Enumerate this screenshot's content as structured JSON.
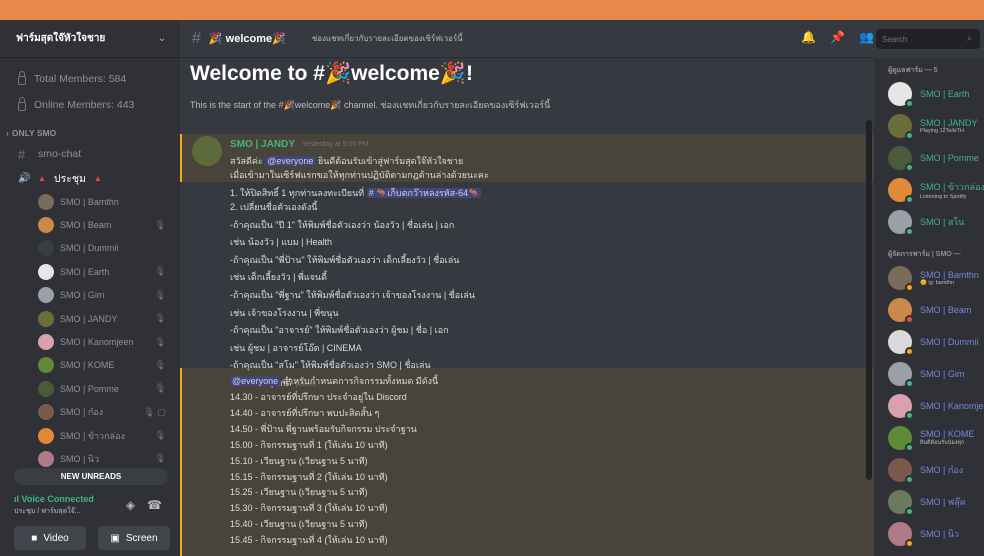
{
  "server": {
    "name": "ฟาร์มสุดใจ๊หัวใจชาย"
  },
  "stats": [
    "Total Members: 584",
    "Online Members: 443"
  ],
  "category": "ONLY SMO",
  "channels": {
    "text": "smo-chat",
    "voice": "ประชุม"
  },
  "voice_users": [
    {
      "name": "SMO | Bamthn",
      "color": "#7a6a5a",
      "mic": ""
    },
    {
      "name": "SMO | Beam",
      "color": "#c9894a",
      "mic": "🎙"
    },
    {
      "name": "SMO | Dummii",
      "color": "#3a3d44",
      "mic": ""
    },
    {
      "name": "SMO | Earth",
      "color": "#e6e6e6",
      "mic": "🎙"
    },
    {
      "name": "SMO | Gim",
      "color": "#9aa0a8",
      "mic": "🎙"
    },
    {
      "name": "SMO | JANDY",
      "color": "#6b6e3a",
      "mic": "🎙"
    },
    {
      "name": "SMO | Kanomjeen",
      "color": "#d9a0b0",
      "mic": "🎙"
    },
    {
      "name": "SMO | KOME",
      "color": "#5f8a3a",
      "mic": "🎙"
    },
    {
      "name": "SMO | Pomme",
      "color": "#4a5a3a",
      "mic": "🎙"
    },
    {
      "name": "SMO | ก๋อง",
      "color": "#7a5a4a",
      "mic": "🎙 ▢"
    },
    {
      "name": "SMO | ข้าวกล่อง",
      "color": "#e08a3a",
      "mic": "🎙"
    },
    {
      "name": "SMO | นิว",
      "color": "#b07a8a",
      "mic": "🎙"
    }
  ],
  "unread_label": "NEW UNREADS",
  "voice_panel": {
    "title": "Voice Connected",
    "sub": "ประชุม / ฟาร์มสุดใจ๊...",
    "video": "Video",
    "screen": "Screen"
  },
  "header": {
    "channel": "welcome",
    "topic": "ช่องแชทเกี่ยวกับรายละเอียดของเซิร์ฟเวอร์นี้"
  },
  "search": {
    "placeholder": "Search"
  },
  "welcome": {
    "title": "Welcome to #🎉welcome🎉!",
    "sub": "This is the start of the #🎉welcome🎉 channel. ช่องแชทเกี่ยวกับรายละเอียดของเซิร์ฟเวอร์นี้"
  },
  "message": {
    "author": "SMO | JANDY",
    "time": "Yesterday at 9:00 PM",
    "greeting_pre": "สวัสดีค่ะ",
    "mention": "@everyone",
    "greeting_post": "ยินดีต้อนรับเข้าสู่ฟาร์มสุดใจ๊หัวใจชาย",
    "l2": "เมื่อเข้ามาในเซิร์ฟแรกขอให้ทุกท่านปฏิบัติตามกฎด้านล่างด้วยนะคะ",
    "l3_pre": "1. ให้ปิดสิทธิ์ 1 ทุกท่านลงทะเบียนที่",
    "l3_chan": "# 🦘เก็บตกว๊าหลงรหัส-64🦘",
    "lines": [
      "2. เปลี่ยนชื่อตัวเองดังนี้",
      "-ถ้าคุณเป็น \"ปี 1\" ให้พิมพ์ชื่อตัวเองว่า น้องวัว | ชื่อเล่น | เอก",
      "เช่น น้องวัว | แบม | Health",
      "-ถ้าคุณเป็น \"พี่ป้าน\" ให้พิมพ์ชื่อตัวเองว่า เด็กเลี้ยงวัว | ชื่อเล่น",
      "เช่น เด็กเลี้ยงวัว | พี่แจนดี้",
      "-ถ้าคุณเป็น \"พี่ฐาน\" ให้พิมพ์ชื่อตัวเองว่า เจ้าของโรงงาน | ชื่อเล่น",
      "เช่น เจ้าของโรงงาน | พี่ขนุน",
      "-ถ้าคุณเป็น \"อาจารย์\" ให้พิมพ์ชื่อตัวเองว่า ผู้ชม | ชื่อ | เอก",
      "เช่น ผู้ชม | อาจารย์โอ๊ต | CINEMA",
      "-ถ้าคุณเป็น \"สโม\" ให้พิมพ์ชื่อตัวเองว่า SMO | ชื่อเล่น",
      "เช่น SMO | ไกด์"
    ],
    "edited": "(edited)",
    "sched_mention": "@everyone",
    "sched_head": "สำหรับกำหนดการกิจกรรมทั้งหมด มีดังนี้",
    "schedule": [
      "14.30 - อาจารย์ที่ปรึกษา ประจำอยู่ใน Discord",
      "14.40 - อาจารย์ที่ปรึกษา พบปะสิดสั้น ๆ",
      "14.50 - พี่ป้าน พี่ฐานพร้อมรับกิจกรรม ประจำฐาน",
      "15.00 - กิจกรรมฐานที่ 1 (ให้เล่น 10 นาที)",
      "15.10 - เวียนฐาน (เวียนฐาน 5 นาที)",
      "15.15 - กิจกรรมฐานที่ 2 (ให้เล่น 10 นาที)",
      "15.25 - เวียนฐาน (เวียนฐาน 5 นาที)",
      "15.30 - กิจกรรมฐานที่ 3 (ให้เล่น 10 นาที)",
      "15.40 - เวียนฐาน (เวียนฐาน 5 นาที)",
      "15.45 - กิจกรรมฐานที่ 4 (ให้เล่น 10 นาที)"
    ]
  },
  "members": {
    "cat1": "ผู้ดูแลฟาร์ม — 5",
    "group1": [
      {
        "name": "SMO | Earth",
        "sub": "",
        "color": "#e6e6e6",
        "status": "#43b581",
        "ncolor": "#43b581"
      },
      {
        "name": "SMO | JANDY",
        "sub": "Playing 12TailsTH",
        "color": "#6b6e3a",
        "status": "#43b581",
        "ncolor": "#43b581"
      },
      {
        "name": "SMO | Pomme",
        "sub": "",
        "color": "#4a5a3a",
        "status": "#43b581",
        "ncolor": "#43b581"
      },
      {
        "name": "SMO | ข้าวกล่อง",
        "sub": "Listening to Spotify",
        "color": "#e08a3a",
        "status": "#43b581",
        "ncolor": "#43b581"
      },
      {
        "name": "SMO | สโน",
        "sub": "",
        "color": "#9aa0a8",
        "status": "#43b581",
        "ncolor": "#43b581"
      }
    ],
    "cat2": "ผู้จัดการฟาร์ม | SMO —",
    "group2": [
      {
        "name": "SMO | Bamthn",
        "sub": "🌞 ig: bamthn",
        "color": "#7a6a5a",
        "status": "#faa61a",
        "ncolor": "#7289da"
      },
      {
        "name": "SMO | Beam",
        "sub": "",
        "color": "#c9894a",
        "status": "#f04747",
        "ncolor": "#7289da"
      },
      {
        "name": "SMO | Dummii",
        "sub": "",
        "color": "#d9d9d9",
        "status": "#faa61a",
        "ncolor": "#7289da"
      },
      {
        "name": "SMO | Gim",
        "sub": "",
        "color": "#9aa0a8",
        "status": "#43b581",
        "ncolor": "#7289da"
      },
      {
        "name": "SMO | Kanomjeen",
        "sub": "",
        "color": "#d9a0b0",
        "status": "#43b581",
        "ncolor": "#7289da"
      },
      {
        "name": "SMO | KOME",
        "sub": "ยินดีต้อนรับน้องทุก",
        "color": "#5f8a3a",
        "status": "#43b581",
        "ncolor": "#7289da"
      },
      {
        "name": "SMO | ก๋อง",
        "sub": "",
        "color": "#7a5a4a",
        "status": "#43b581",
        "ncolor": "#7289da"
      },
      {
        "name": "SMO | ฟลุ๊ค",
        "sub": "",
        "color": "#6a7a5a",
        "status": "#43b581",
        "ncolor": "#7289da"
      },
      {
        "name": "SMO | นิว",
        "sub": "",
        "color": "#b07a8a",
        "status": "#faa61a",
        "ncolor": "#7289da"
      }
    ]
  }
}
